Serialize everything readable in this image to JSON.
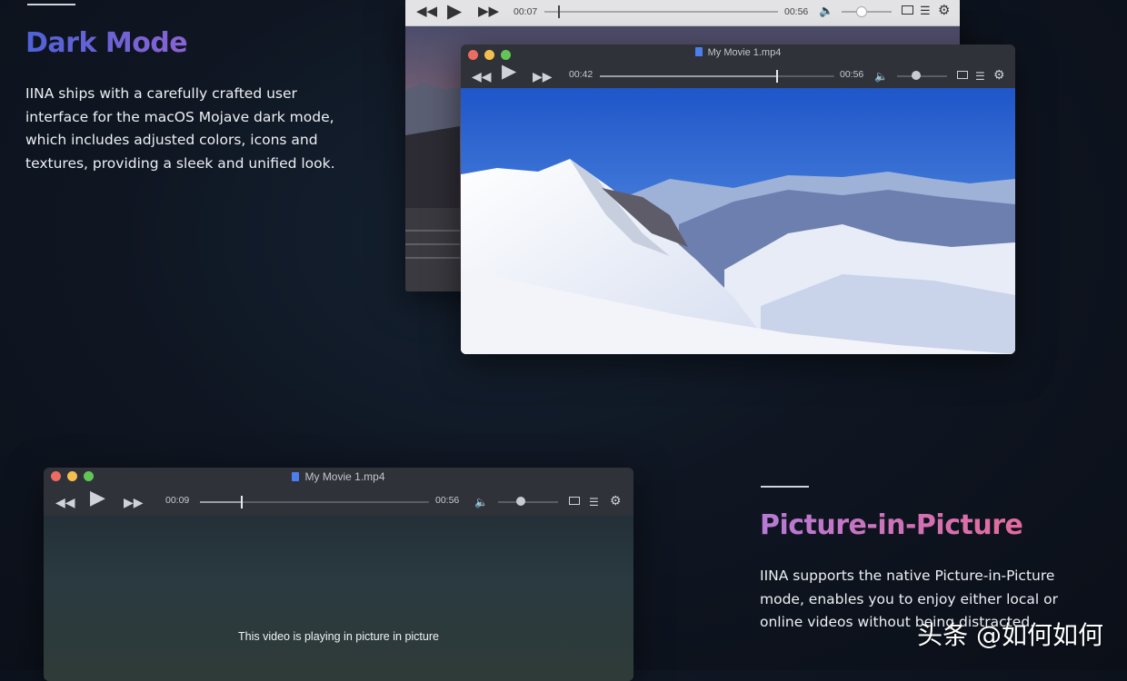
{
  "dark_mode": {
    "title": "Dark Mode",
    "lines": [
      "IINA ships with a carefully crafted user",
      "interface for the macOS Mojave dark mode,",
      "which includes adjusted colors, icons and",
      "textures, providing a sleek and unified look."
    ]
  },
  "pip": {
    "title": "Picture-in-Picture",
    "lines": [
      "IINA supports the native Picture-in-Picture",
      "mode, enables you to enjoy either local or",
      "online videos without being distracted."
    ]
  },
  "back_window": {
    "current_time": "00:07",
    "duration": "00:56",
    "progress": 0.06
  },
  "front_window": {
    "title": "My Movie 1.mp4",
    "current_time": "00:42",
    "duration": "00:56",
    "progress": 0.75
  },
  "pip_window": {
    "title": "My Movie 1.mp4",
    "current_time": "00:09",
    "duration": "00:56",
    "progress": 0.18,
    "message": "This video is playing in picture in picture"
  },
  "icons": [
    "rewind-icon",
    "play-icon",
    "fast-forward-icon",
    "volume-icon",
    "pip-icon",
    "playlist-icon",
    "gear-icon"
  ],
  "watermark": "头条 @如何如何"
}
